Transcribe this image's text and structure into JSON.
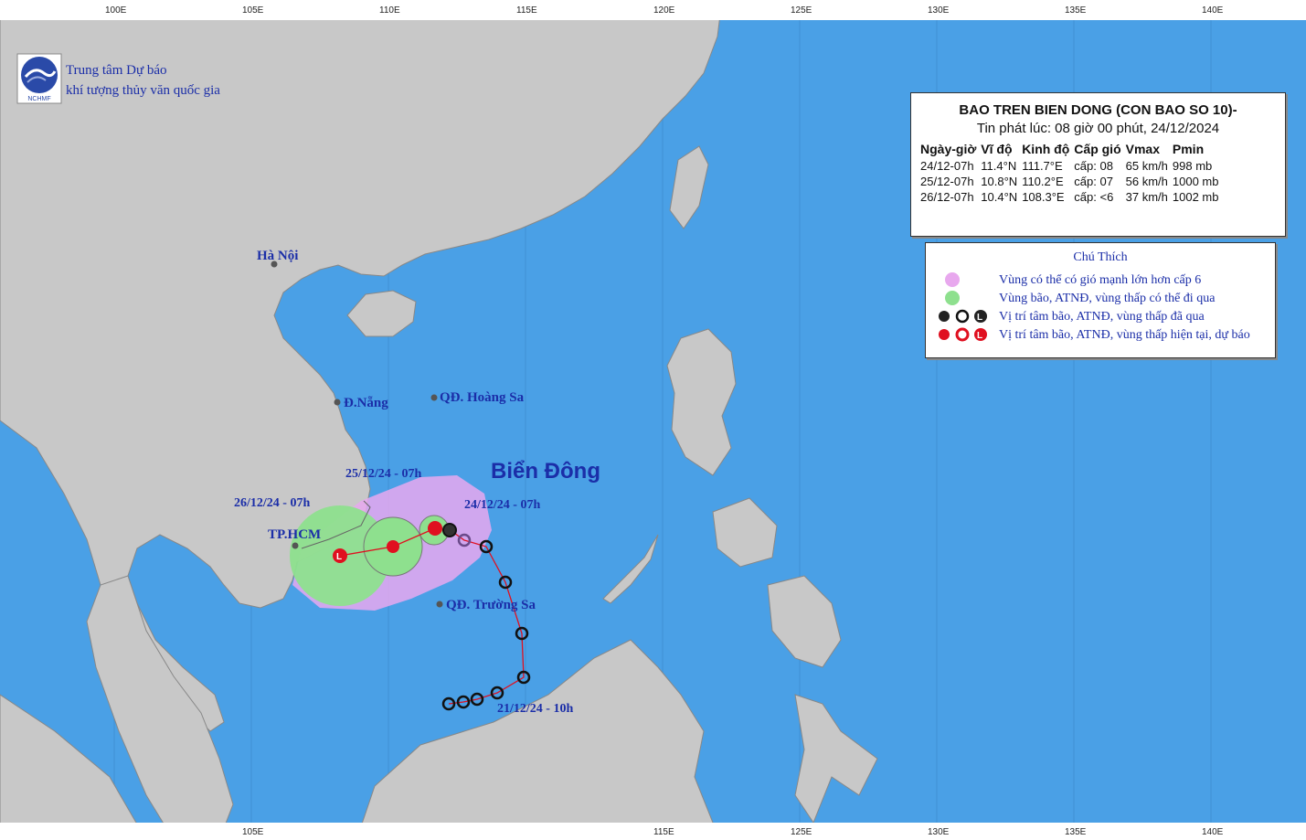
{
  "org": {
    "line1": "Trung tâm Dự báo",
    "line2": "khí tượng thủy văn quốc gia",
    "logo_text": "NCHMF"
  },
  "axis": {
    "top": [
      "100E",
      "105E",
      "110E",
      "115E",
      "120E",
      "125E",
      "130E",
      "135E",
      "140E"
    ],
    "bottom": [
      "105E",
      "115E",
      "125E",
      "130E",
      "135E",
      "140E"
    ]
  },
  "info": {
    "title": "BAO TREN BIEN DONG (CON BAO SO 10)-",
    "issued": "Tin phát lúc: 08 giờ 00 phút, 24/12/2024",
    "headers": [
      "Ngày-giờ",
      "Vĩ độ",
      "Kinh độ",
      "Cấp gió",
      "Vmax",
      "Pmin"
    ],
    "rows": [
      [
        "24/12-07h",
        "11.4°N",
        "111.7°E",
        "cấp: 08",
        "65 km/h",
        "998 mb"
      ],
      [
        "25/12-07h",
        "10.8°N",
        "110.2°E",
        "cấp: 07",
        "56 km/h",
        "1000 mb"
      ],
      [
        "26/12-07h",
        "10.4°N",
        "108.3°E",
        "cấp: <6",
        "37 km/h",
        "1002 mb"
      ]
    ]
  },
  "legend": {
    "title": "Chú Thích",
    "items": [
      {
        "label": "Vùng có thể có gió mạnh lớn hơn cấp 6",
        "color": "#e8a8ee"
      },
      {
        "label": "Vùng bão, ATNĐ, vùng thấp có thể đi qua",
        "color": "#8ee08e"
      },
      {
        "label": "Vị trí tâm bão, ATNĐ, vùng thấp đã qua",
        "color": "#111111"
      },
      {
        "label": "Vị trí tâm bão, ATNĐ, vùng thấp hiện tại, dự báo",
        "color": "#e01020"
      }
    ]
  },
  "places": {
    "hanoi": "Hà Nội",
    "danang": "Đ.Nẵng",
    "hoangsa": "QĐ. Hoàng Sa",
    "hcm": "TP.HCM",
    "truongsa": "QĐ. Trường Sa",
    "sea": "Biển Đông"
  },
  "track_labels": {
    "t1": "25/12/24 - 07h",
    "t2": "26/12/24 - 07h",
    "t3": "24/12/24 - 07h",
    "t4": "21/12/24 - 10h"
  },
  "colors": {
    "sea": "#4aa0e6",
    "land": "#c8c8c8",
    "text": "#1b2ea8",
    "track": "#e01020"
  }
}
